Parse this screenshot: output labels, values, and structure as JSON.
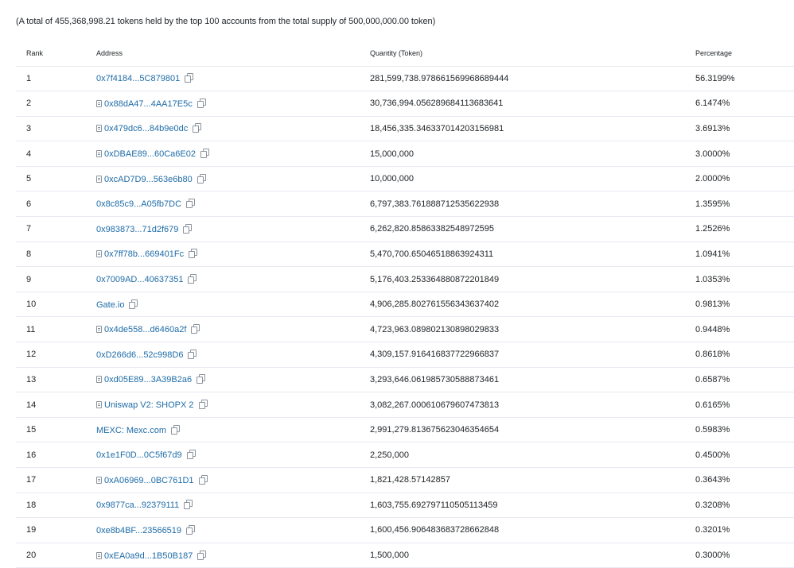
{
  "summary": "(A total of 455,368,998.21 tokens held by the top 100 accounts from the total supply of 500,000,000.00 token)",
  "table": {
    "headers": {
      "rank": "Rank",
      "address": "Address",
      "quantity": "Quantity (Token)",
      "percentage": "Percentage"
    },
    "rows": [
      {
        "rank": "1",
        "address": "0x7f4184...5C879801",
        "contract": false,
        "quantity": "281,599,738.978661569968689444",
        "percentage": "56.3199%"
      },
      {
        "rank": "2",
        "address": "0x88dA47...4AA17E5c",
        "contract": true,
        "quantity": "30,736,994.056289684113683641",
        "percentage": "6.1474%"
      },
      {
        "rank": "3",
        "address": "0x479dc6...84b9e0dc",
        "contract": true,
        "quantity": "18,456,335.346337014203156981",
        "percentage": "3.6913%"
      },
      {
        "rank": "4",
        "address": "0xDBAE89...60Ca6E02",
        "contract": true,
        "quantity": "15,000,000",
        "percentage": "3.0000%"
      },
      {
        "rank": "5",
        "address": "0xcAD7D9...563e6b80",
        "contract": true,
        "quantity": "10,000,000",
        "percentage": "2.0000%"
      },
      {
        "rank": "6",
        "address": "0x8c85c9...A05fb7DC",
        "contract": false,
        "quantity": "6,797,383.761888712535622938",
        "percentage": "1.3595%"
      },
      {
        "rank": "7",
        "address": "0x983873...71d2f679",
        "contract": false,
        "quantity": "6,262,820.85863382548972595",
        "percentage": "1.2526%"
      },
      {
        "rank": "8",
        "address": "0x7ff78b...669401Fc",
        "contract": true,
        "quantity": "5,470,700.65046518863924311",
        "percentage": "1.0941%"
      },
      {
        "rank": "9",
        "address": "0x7009AD...40637351",
        "contract": false,
        "quantity": "5,176,403.253364880872201849",
        "percentage": "1.0353%"
      },
      {
        "rank": "10",
        "address": "Gate.io",
        "contract": false,
        "quantity": "4,906,285.802761556343637402",
        "percentage": "0.9813%"
      },
      {
        "rank": "11",
        "address": "0x4de558...d6460a2f",
        "contract": true,
        "quantity": "4,723,963.089802130898029833",
        "percentage": "0.9448%"
      },
      {
        "rank": "12",
        "address": "0xD266d6...52c998D6",
        "contract": false,
        "quantity": "4,309,157.916416837722966837",
        "percentage": "0.8618%"
      },
      {
        "rank": "13",
        "address": "0xd05E89...3A39B2a6",
        "contract": true,
        "quantity": "3,293,646.061985730588873461",
        "percentage": "0.6587%"
      },
      {
        "rank": "14",
        "address": "Uniswap V2: SHOPX 2",
        "contract": true,
        "quantity": "3,082,267.000610679607473813",
        "percentage": "0.6165%"
      },
      {
        "rank": "15",
        "address": "MEXC: Mexc.com",
        "contract": false,
        "quantity": "2,991,279.813675623046354654",
        "percentage": "0.5983%"
      },
      {
        "rank": "16",
        "address": "0x1e1F0D...0C5f67d9",
        "contract": false,
        "quantity": "2,250,000",
        "percentage": "0.4500%"
      },
      {
        "rank": "17",
        "address": "0xA06969...0BC761D1",
        "contract": true,
        "quantity": "1,821,428.57142857",
        "percentage": "0.3643%"
      },
      {
        "rank": "18",
        "address": "0x9877ca...92379111",
        "contract": false,
        "quantity": "1,603,755.692797110505113459",
        "percentage": "0.3208%"
      },
      {
        "rank": "19",
        "address": "0xe8b4BF...23566519",
        "contract": false,
        "quantity": "1,600,456.906483683728662848",
        "percentage": "0.3201%"
      },
      {
        "rank": "20",
        "address": "0xEA0a9d...1B50B187",
        "contract": true,
        "quantity": "1,500,000",
        "percentage": "0.3000%"
      }
    ]
  },
  "colors": {
    "link": "#1e6ca8",
    "text": "#212529",
    "border": "#e7eaf3",
    "icon": "#8a929c"
  },
  "icons": {
    "contract": "file-contract-icon",
    "copy": "copy-icon"
  }
}
